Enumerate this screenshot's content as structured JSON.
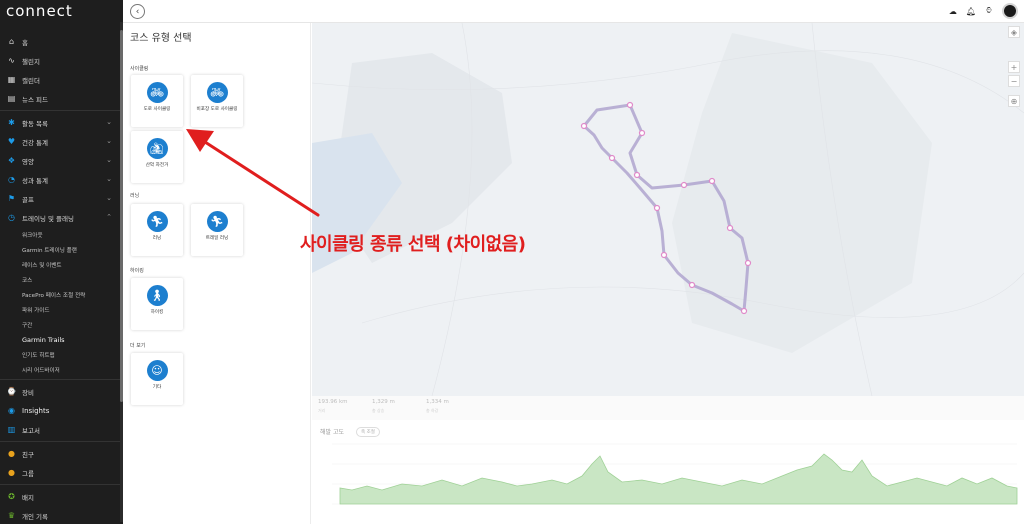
{
  "app": {
    "logo": "connect"
  },
  "sidebar": {
    "items": [
      {
        "icon": "home-icon",
        "label": "홈"
      },
      {
        "icon": "activity-wave-icon",
        "label": "챌린지"
      },
      {
        "icon": "calendar-icon",
        "label": "캘린더"
      },
      {
        "icon": "newsfeed-icon",
        "label": "뉴스 피드"
      }
    ],
    "groups": [
      {
        "icon": "running-person-icon",
        "label": "활동 목록"
      },
      {
        "icon": "heart-icon",
        "label": "건강 통계"
      },
      {
        "icon": "nutrition-icon",
        "label": "영양"
      },
      {
        "icon": "performance-icon",
        "label": "성과 통계"
      },
      {
        "icon": "golf-icon",
        "label": "골프"
      },
      {
        "icon": "training-icon",
        "label": "트레이닝 및 플래닝"
      }
    ],
    "sub_items": [
      "워크아웃",
      "Garmin 트레이닝 플랜",
      "레이스 및 이벤트",
      "코스",
      "PacePro 페이스 조절 전략",
      "파워 가이드",
      "구간",
      "Garmin Trails",
      "인기도 히트맵",
      "시리 어드바이저"
    ],
    "bottom": [
      {
        "icon": "gear-device-icon",
        "label": "장비"
      },
      {
        "icon": "insights-icon",
        "label": "Insights"
      },
      {
        "icon": "reports-icon",
        "label": "보고서"
      },
      {
        "icon": "friends-icon",
        "label": "친구"
      },
      {
        "icon": "groups-icon",
        "label": "그룹"
      },
      {
        "icon": "badge-icon",
        "label": "배지"
      },
      {
        "icon": "trophy-icon",
        "label": "개인 기록"
      }
    ]
  },
  "panel": {
    "title": "코스 유형 선택",
    "sections": [
      {
        "label": "사이클링",
        "cards": [
          "도로 사이클링",
          "비포장 도로 사이클링",
          "산악 자전거"
        ]
      },
      {
        "label": "러닝",
        "cards": [
          "러닝",
          "트레일 러닝"
        ]
      },
      {
        "label": "하이킹",
        "cards": [
          "하이킹"
        ]
      },
      {
        "label": "더 보기",
        "cards": [
          "기타"
        ]
      }
    ]
  },
  "stats": [
    {
      "value": "193.96 km",
      "label": "거리"
    },
    {
      "value": "1,329 m",
      "label": "총 상승"
    },
    {
      "value": "1,334 m",
      "label": "총 하강"
    }
  ],
  "elevation": {
    "title": "해발 고도",
    "button": "축 조절"
  },
  "annotation": {
    "text": "사이클링 종류 선택 (차이없음)",
    "color": "#e01e1e"
  },
  "colors": {
    "accent": "#1d7fcf",
    "sidebar_bg": "#1e1e1e",
    "route": "#b3a9d0",
    "elevation_fill": "#c9e6c4"
  }
}
